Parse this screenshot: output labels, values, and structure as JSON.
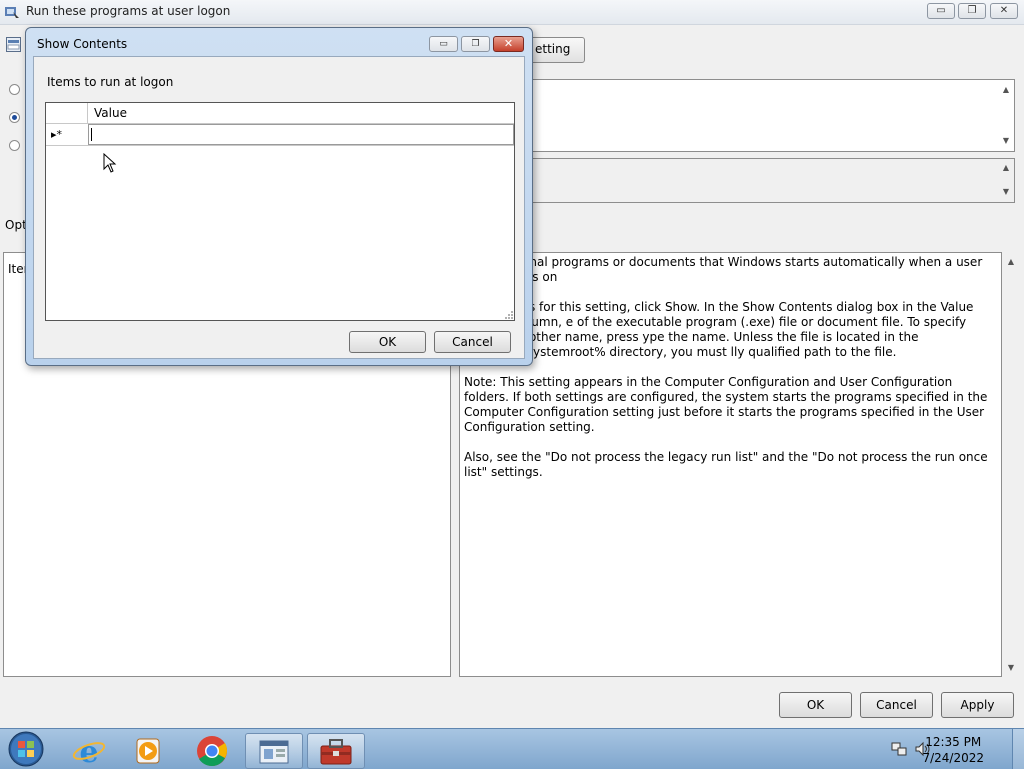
{
  "main_window": {
    "title": "Run these programs at user logon",
    "minimize_label": "▭",
    "restore_label": "❐",
    "close_label": "✕",
    "setting_button_partial": "etting",
    "options_label_partial": "Opt",
    "items_label_partial": "Iten",
    "help_paragraphs": [
      "tional programs or documents that Windows starts automatically when a user logs on",
      "ues for this setting, click Show. In the Show Contents dialog box in the Value column, e of the executable program (.exe) file or document file. To specify another name, press ype the name. Unless the file is located in the %Systemroot% directory, you must lly qualified path to the file.",
      "Note: This setting appears in the Computer Configuration and User Configuration folders. If both settings are configured, the system starts the programs specified in the Computer Configuration setting just before it starts the programs specified in the User Configuration setting.",
      "Also, see the \"Do not process the legacy run list\" and the \"Do not process the run once list\" settings."
    ],
    "buttons": {
      "ok": "OK",
      "cancel": "Cancel",
      "apply": "Apply"
    }
  },
  "dialog": {
    "title": "Show Contents",
    "items_label": "Items to run at logon",
    "grid": {
      "column_header": "Value",
      "new_row_marker": "▸*",
      "rows": [
        {
          "value": ""
        }
      ]
    },
    "buttons": {
      "ok": "OK",
      "cancel": "Cancel"
    }
  },
  "taskbar": {
    "apps": [
      "start-orb",
      "internet-explorer",
      "media-player",
      "chrome",
      "group-policy-editor",
      "toolbox"
    ],
    "time": "12:35 PM",
    "date": "7/24/2022"
  }
}
